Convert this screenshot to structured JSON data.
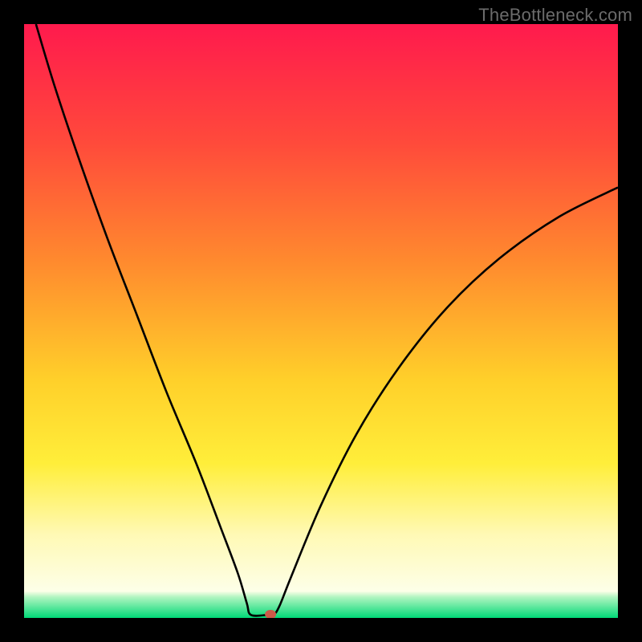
{
  "watermark": "TheBottleneck.com",
  "chart_data": {
    "type": "line",
    "title": "",
    "xlabel": "",
    "ylabel": "",
    "xlim": [
      0,
      100
    ],
    "ylim": [
      0,
      100
    ],
    "grid": false,
    "legend": false,
    "background": {
      "type": "vertical-gradient",
      "stops": [
        {
          "at": 0.0,
          "color": "#ff1a4d"
        },
        {
          "at": 0.2,
          "color": "#ff4a3b"
        },
        {
          "at": 0.4,
          "color": "#ff8a2e"
        },
        {
          "at": 0.6,
          "color": "#ffd02a"
        },
        {
          "at": 0.74,
          "color": "#ffee3a"
        },
        {
          "at": 0.86,
          "color": "#fff9b5"
        },
        {
          "at": 0.955,
          "color": "#fdffe8"
        },
        {
          "at": 0.965,
          "color": "#b0f5c0"
        },
        {
          "at": 1.0,
          "color": "#00d977"
        }
      ]
    },
    "series": [
      {
        "name": "bottleneck-curve",
        "stroke": "#000000",
        "stroke_width": 2,
        "points": [
          {
            "x": 2.0,
            "y": 100.0
          },
          {
            "x": 5.0,
            "y": 90.0
          },
          {
            "x": 9.0,
            "y": 78.0
          },
          {
            "x": 14.0,
            "y": 64.0
          },
          {
            "x": 19.0,
            "y": 51.0
          },
          {
            "x": 24.0,
            "y": 38.0
          },
          {
            "x": 29.0,
            "y": 26.0
          },
          {
            "x": 33.0,
            "y": 15.5
          },
          {
            "x": 36.0,
            "y": 7.5
          },
          {
            "x": 37.5,
            "y": 2.5
          },
          {
            "x": 38.2,
            "y": 0.5
          },
          {
            "x": 41.0,
            "y": 0.5
          },
          {
            "x": 42.0,
            "y": 0.5
          },
          {
            "x": 43.0,
            "y": 2.0
          },
          {
            "x": 45.0,
            "y": 7.0
          },
          {
            "x": 50.0,
            "y": 19.0
          },
          {
            "x": 56.0,
            "y": 31.0
          },
          {
            "x": 63.0,
            "y": 42.0
          },
          {
            "x": 71.0,
            "y": 52.0
          },
          {
            "x": 80.0,
            "y": 60.5
          },
          {
            "x": 90.0,
            "y": 67.5
          },
          {
            "x": 100.0,
            "y": 72.5
          }
        ]
      }
    ],
    "marker": {
      "name": "optimal-point",
      "x": 41.5,
      "y": 0.6,
      "color": "#cc5a48",
      "rx": 7,
      "ry": 5.5
    }
  }
}
